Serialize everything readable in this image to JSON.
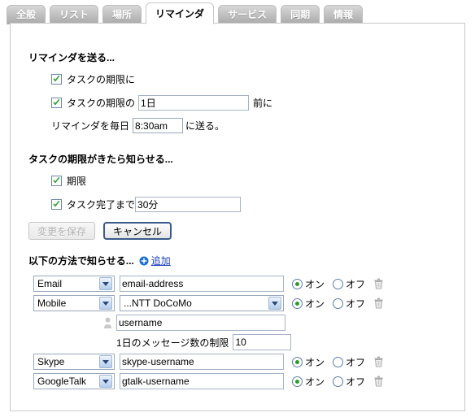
{
  "tabs": [
    {
      "label": "全般",
      "active": false
    },
    {
      "label": "リスト",
      "active": false
    },
    {
      "label": "場所",
      "active": false
    },
    {
      "label": "リマインダ",
      "active": true
    },
    {
      "label": "サービス",
      "active": false
    },
    {
      "label": "同期",
      "active": false
    },
    {
      "label": "情報",
      "active": false
    }
  ],
  "reminder_section": {
    "title": "リマインダを送る...",
    "due_checkbox": {
      "label": "タスクの期限に",
      "checked": true
    },
    "before_checkbox": {
      "label": "タスクの期限の",
      "checked": true
    },
    "before_value": "1日",
    "before_suffix": "前に",
    "daily_prefix": "リマインダを毎日",
    "daily_time": "8:30am",
    "daily_suffix": "に送る。"
  },
  "overdue_section": {
    "title": "タスクの期限がきたら知らせる...",
    "due_checkbox": {
      "label": "期限",
      "checked": true
    },
    "until_checkbox": {
      "label": "タスク完了まで",
      "checked": true
    },
    "until_value": "30分"
  },
  "buttons": {
    "save": "変更を保存",
    "save_disabled": true,
    "cancel": "キャンセル"
  },
  "methods_section": {
    "title": "以下の方法で知らせる...",
    "add_label": "追加",
    "add_icon": "plus-circle-icon",
    "on_label": "オン",
    "off_label": "オフ",
    "mobile_extra": {
      "username_value": "username",
      "user_icon": "user-icon",
      "limit_label": "1日のメッセージ数の制限",
      "limit_value": "10"
    },
    "rows": [
      {
        "type": "Email",
        "value_kind": "text",
        "value": "email-address",
        "state": "on"
      },
      {
        "type": "Mobile",
        "value_kind": "select",
        "value": "...NTT DoCoMo",
        "state": "on"
      },
      {
        "type": "Skype",
        "value_kind": "text",
        "value": "skype-username",
        "state": "on"
      },
      {
        "type": "GoogleTalk",
        "value_kind": "text",
        "value": "gtalk-username",
        "state": "on"
      }
    ]
  },
  "colors": {
    "link": "#1a3fb8",
    "check_green": "#2b9c2b",
    "default_button_border": "#3b5a8c"
  }
}
